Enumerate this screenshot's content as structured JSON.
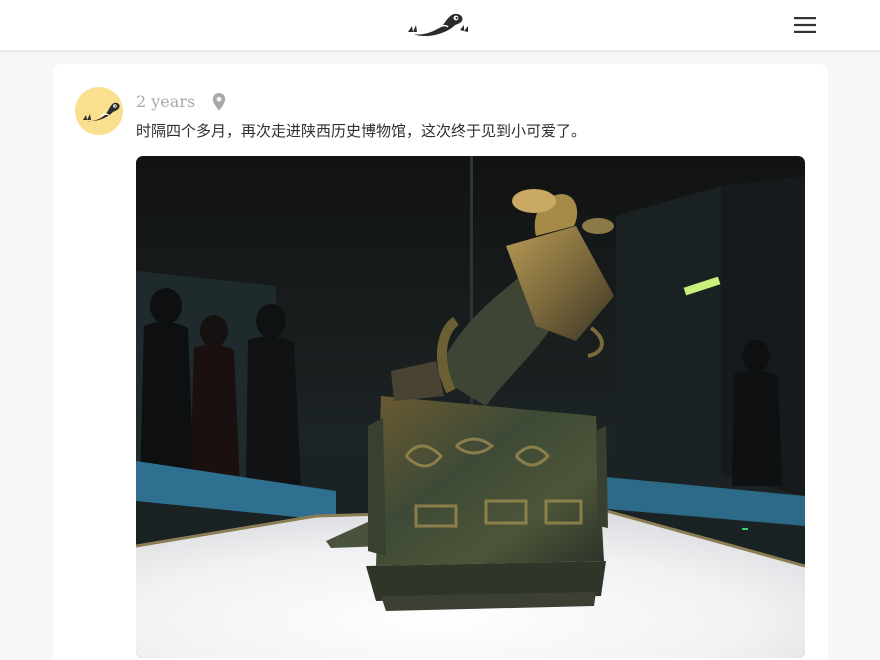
{
  "header": {
    "logo_icon": "fish-bird-logo-icon",
    "menu_icon": "hamburger-menu-icon"
  },
  "post": {
    "time": "2 years",
    "location_icon": "location-pin-icon",
    "text": "时隔四个多月，再次走进陕西历史博物馆，这次终于见到小可爱了。",
    "avatar_icon": "fish-bird-avatar-icon",
    "photo_subject": "bronze-vessel-photo"
  },
  "colors": {
    "avatar_bg": "#f9df8e",
    "meta_gray": "#a9a9a9",
    "icon_dark": "#2b2b2b"
  }
}
